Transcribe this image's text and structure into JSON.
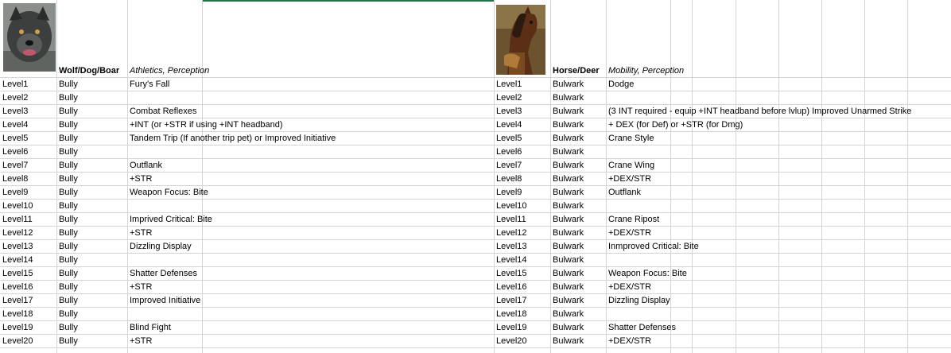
{
  "left": {
    "species": "Wolf/Dog/Boar",
    "skills": "Athletics, Perception",
    "portrait_icon": "wolf-portrait",
    "rows": [
      {
        "level": "Level1",
        "class": "Bully",
        "note": "Fury's Fall"
      },
      {
        "level": "Level2",
        "class": "Bully",
        "note": ""
      },
      {
        "level": "Level3",
        "class": "Bully",
        "note": "Combat Reflexes"
      },
      {
        "level": "Level4",
        "class": "Bully",
        "note": "+INT (or +STR if using +INT headband)"
      },
      {
        "level": "Level5",
        "class": "Bully",
        "note": "Tandem Trip (If another trip pet) or Improved Initiative"
      },
      {
        "level": "Level6",
        "class": "Bully",
        "note": ""
      },
      {
        "level": "Level7",
        "class": "Bully",
        "note": "Outflank"
      },
      {
        "level": "Level8",
        "class": "Bully",
        "note": "+STR"
      },
      {
        "level": "Level9",
        "class": "Bully",
        "note": "Weapon Focus: Bite"
      },
      {
        "level": "Level10",
        "class": "Bully",
        "note": ""
      },
      {
        "level": "Level11",
        "class": "Bully",
        "note": "Imprived Critical: Bite"
      },
      {
        "level": "Level12",
        "class": "Bully",
        "note": "+STR"
      },
      {
        "level": "Level13",
        "class": "Bully",
        "note": "Dizzling Display"
      },
      {
        "level": "Level14",
        "class": "Bully",
        "note": ""
      },
      {
        "level": "Level15",
        "class": "Bully",
        "note": "Shatter Defenses"
      },
      {
        "level": "Level16",
        "class": "Bully",
        "note": "+STR"
      },
      {
        "level": "Level17",
        "class": "Bully",
        "note": "Improved Initiative"
      },
      {
        "level": "Level18",
        "class": "Bully",
        "note": ""
      },
      {
        "level": "Level19",
        "class": "Bully",
        "note": "Blind Fight"
      },
      {
        "level": "Level20",
        "class": "Bully",
        "note": "+STR"
      }
    ]
  },
  "right": {
    "species": "Horse/Deer",
    "skills": "Mobility, Perception",
    "portrait_icon": "horse-portrait",
    "rows": [
      {
        "level": "Level1",
        "class": "Bulwark",
        "note": "Dodge"
      },
      {
        "level": "Level2",
        "class": "Bulwark",
        "note": ""
      },
      {
        "level": "Level3",
        "class": "Bulwark",
        "note": "(3 INT required - equip +INT headband before lvlup) Improved Unarmed Strike"
      },
      {
        "level": "Level4",
        "class": "Bulwark",
        "note": "+ DEX (for Def) or +STR (for Dmg)"
      },
      {
        "level": "Level5",
        "class": "Bulwark",
        "note": "Crane Style"
      },
      {
        "level": "Level6",
        "class": "Bulwark",
        "note": ""
      },
      {
        "level": "Level7",
        "class": "Bulwark",
        "note": "Crane Wing"
      },
      {
        "level": "Level8",
        "class": "Bulwark",
        "note": "+DEX/STR"
      },
      {
        "level": "Level9",
        "class": "Bulwark",
        "note": "Outflank"
      },
      {
        "level": "Level10",
        "class": "Bulwark",
        "note": ""
      },
      {
        "level": "Level11",
        "class": "Bulwark",
        "note": "Crane Ripost"
      },
      {
        "level": "Level12",
        "class": "Bulwark",
        "note": "+DEX/STR"
      },
      {
        "level": "Level13",
        "class": "Bulwark",
        "note": "Inmproved Critical: Bite"
      },
      {
        "level": "Level14",
        "class": "Bulwark",
        "note": ""
      },
      {
        "level": "Level15",
        "class": "Bulwark",
        "note": "Weapon Focus: Bite"
      },
      {
        "level": "Level16",
        "class": "Bulwark",
        "note": "+DEX/STR"
      },
      {
        "level": "Level17",
        "class": "Bulwark",
        "note": "Dizzling Display"
      },
      {
        "level": "Level18",
        "class": "Bulwark",
        "note": ""
      },
      {
        "level": "Level19",
        "class": "Bulwark",
        "note": "Shatter Defenses"
      },
      {
        "level": "Level20",
        "class": "Bulwark",
        "note": "+DEX/STR"
      }
    ]
  },
  "colors": {
    "gridline": "#d4d4d4",
    "selection": "#217346"
  }
}
